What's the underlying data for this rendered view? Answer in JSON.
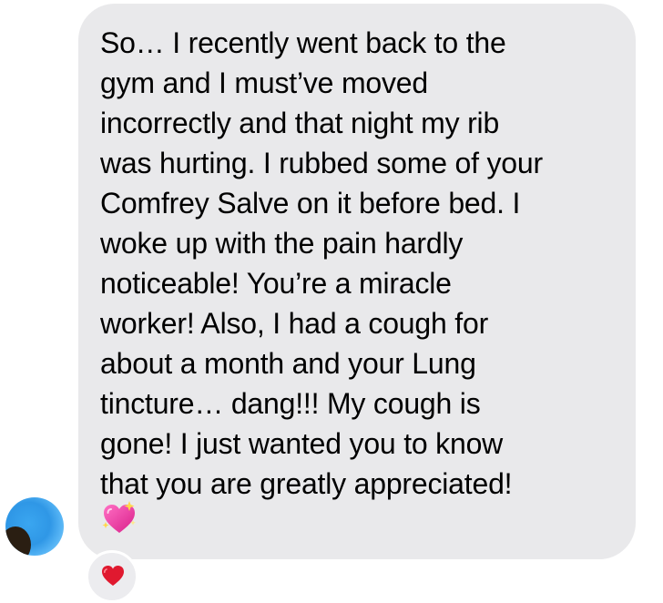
{
  "conversation": {
    "incoming_message": {
      "text": "So… I recently went back to the\ngym and I must’ve moved\nincorrectly and that night my rib\nwas hurting. I rubbed some of your\nComfrey Salve on it before bed. I\nwoke up with the pain hardly\nnoticeable! You’re a miracle\nworker! Also, I had a cough for\nabout a month and your Lung\ntincture… dang!!! My cough is\ngone! I just wanted you to know\nthat you are greatly appreciated!",
      "trailing_emoji": "sparkling-heart-icon",
      "reaction": "red-heart-icon"
    },
    "sender": {
      "avatar": "blurred-avatar"
    }
  },
  "colors": {
    "bubble_background": "#e9e9eb",
    "text": "#000000",
    "heart_red": "#e0192f",
    "sparkle_pink": "#f03c9c"
  }
}
